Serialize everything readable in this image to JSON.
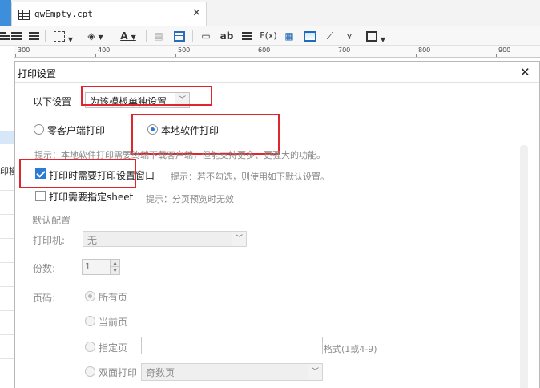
{
  "tab": {
    "title": "gwEmpty.cpt",
    "close": "✕"
  },
  "toolbar": {
    "text_style": "ab",
    "formula": "F(x)"
  },
  "ruler": {
    "ticks": [
      "300",
      "400",
      "500",
      "600",
      "700",
      "800",
      "900"
    ]
  },
  "sheet": {
    "cell_text": "印模"
  },
  "dialog": {
    "title": "打印设置",
    "close": "✕",
    "settings_label": "以下设置",
    "settings_select": "为该模板单独设置",
    "radio_client": "零客户端打印",
    "radio_local": "本地软件打印",
    "hint_local": "提示：本地软件打印需要终端下载客户端，但能支持更多、更强大的功能。",
    "check_dialog": "打印时需要打印设置窗口",
    "hint_dialog": "提示：若不勾选，则使用如下默认设置。",
    "check_sheet": "打印需要指定sheet",
    "hint_sheet": "提示：分页预览时无效",
    "default_group": "默认配置",
    "printer_label": "打印机:",
    "printer_value": "无",
    "copies_label": "份数:",
    "copies_value": "1",
    "pages_label": "页码:",
    "all_pages": "所有页",
    "current_page": "当前页",
    "specified_page": "指定页",
    "page_format": "格式(1或4-9)",
    "duplex": "双面打印",
    "duplex_value": "奇数页"
  },
  "colors": {
    "highlight": "#e0262c",
    "accent": "#2b7bd6"
  }
}
